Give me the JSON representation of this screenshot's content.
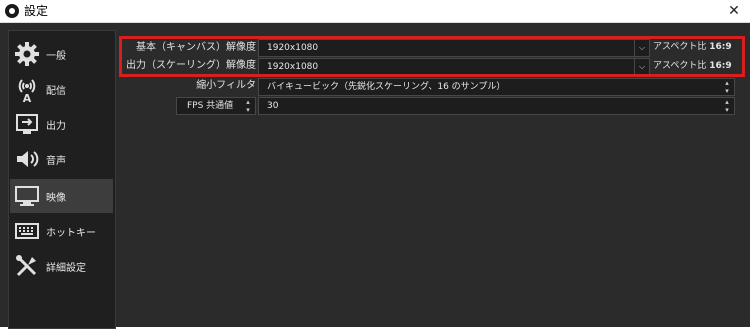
{
  "window": {
    "title": "設定",
    "close_glyph": "✕"
  },
  "sidebar": {
    "items": [
      {
        "label": "一般",
        "icon": "gear-icon",
        "selected": false
      },
      {
        "label": "配信",
        "icon": "broadcast-icon",
        "selected": false
      },
      {
        "label": "出力",
        "icon": "output-icon",
        "selected": false
      },
      {
        "label": "音声",
        "icon": "speaker-icon",
        "selected": false
      },
      {
        "label": "映像",
        "icon": "monitor-icon",
        "selected": true
      },
      {
        "label": "ホットキー",
        "icon": "keyboard-icon",
        "selected": false
      },
      {
        "label": "詳細設定",
        "icon": "tools-icon",
        "selected": false
      }
    ]
  },
  "video": {
    "base_resolution": {
      "label": "基本（キャンバス）解像度",
      "value": "1920x1080",
      "aspect_prefix": "アスペクト比",
      "aspect_value": "16:9"
    },
    "output_resolution": {
      "label": "出力（スケーリング）解像度",
      "value": "1920x1080",
      "aspect_prefix": "アスペクト比",
      "aspect_value": "16:9"
    },
    "downscale_filter": {
      "label": "縮小フィルタ",
      "value": "バイキュービック（先鋭化スケーリング、16 のサンプル）"
    },
    "fps": {
      "type_label": "FPS 共通値",
      "value": "30"
    }
  },
  "colors": {
    "highlight": "#d81f1f",
    "background": "#2b2b2b",
    "sidebar": "#1f1f1f",
    "selected": "#3d3d3d"
  }
}
